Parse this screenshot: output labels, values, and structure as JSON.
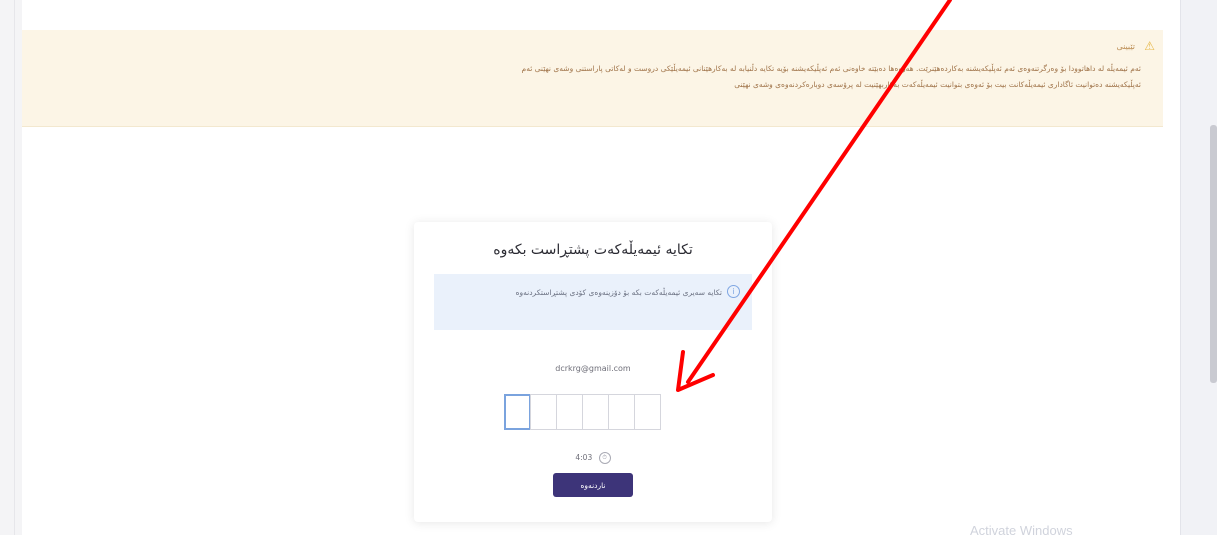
{
  "notice": {
    "icon": "warning-icon",
    "title": "تێبینی",
    "body": "ئەم ئیمەیڵە لە داهاتوودا بۆ وەرگرتنەوەی ئەم ئەپڵیکەیشنە بەکاردەهێنرێت. هەروەها دەبێتە خاوەنی ئەم ئەپڵیکەیشنە بۆیە تکایە دڵنیابە لە بەکارهێنانی ئیمەیڵێکی دروست و لەکاتی پاراستنی وشەی نهێنی ئەم ئەپڵیکەیشنە دەتوانیت ئاگاداری ئیمەیڵەکانت بیت بۆ ئەوەی بتوانیت ئیمەیڵەکەت بەکاربهێنیت لە پرۆسەی دوبارەکردنەوەی وشەی نهێنی"
  },
  "card": {
    "title": "تکایە ئیمەیڵەکەت پشتڕاست بکەوە",
    "info_icon": "info-icon",
    "info_text": "تکایە سەیری ئیمەیڵەکەت بکە بۆ دۆزینەوەی کۆدی پشتڕاستکردنەوە",
    "email": "dcrkrg@gmail.com",
    "otp_values": [
      "",
      "",
      "",
      "",
      "",
      ""
    ],
    "timer": "4:03",
    "timer_icon": "clock-icon",
    "verify_label": "ناردنەوە"
  },
  "watermark": "Activate Windows",
  "annotation": {
    "color": "#ff0000",
    "type": "red-arrow"
  }
}
